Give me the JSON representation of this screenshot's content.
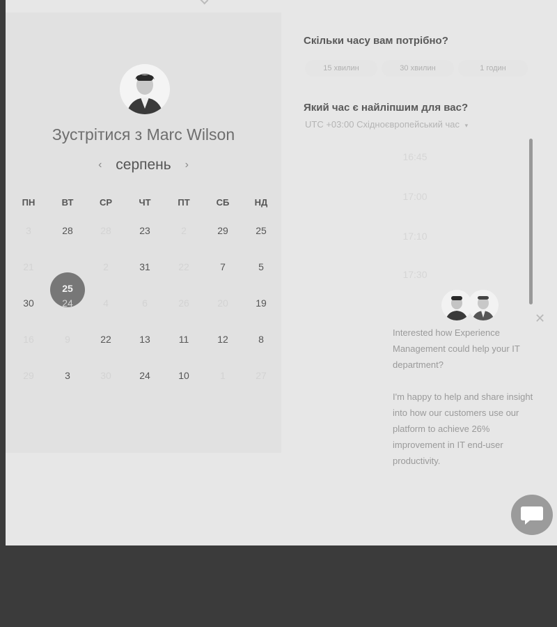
{
  "meeting": {
    "title": "Зустрітися з Marc Wilson",
    "avatar_icon": "person-photo-icon"
  },
  "calendar": {
    "month": "серпень",
    "prev_icon": "chevron-left-icon",
    "next_icon": "chevron-right-icon",
    "weekdays": [
      "ПН",
      "ВТ",
      "СР",
      "ЧТ",
      "ПТ",
      "СБ",
      "НД"
    ],
    "rows": [
      [
        {
          "t": "3",
          "dim": true
        },
        {
          "t": "28"
        },
        {
          "t": "28",
          "dim": true
        },
        {
          "t": "23"
        },
        {
          "t": "2",
          "dim": true
        },
        {
          "t": "29"
        },
        {
          "t": "25"
        }
      ],
      [
        {
          "t": "21",
          "dim": true
        },
        {
          "t": "25",
          "selected": true
        },
        {
          "t": "2",
          "dim": true
        },
        {
          "t": "31"
        },
        {
          "t": "22",
          "dim": true
        },
        {
          "t": "7"
        },
        {
          "t": "5"
        }
      ],
      [
        {
          "t": "30"
        },
        {
          "t": "24",
          "dim": true
        },
        {
          "t": "4",
          "dim": true
        },
        {
          "t": "6",
          "dim": true
        },
        {
          "t": "26",
          "dim": true
        },
        {
          "t": "20",
          "dim": true
        },
        {
          "t": "19"
        }
      ],
      [
        {
          "t": "16",
          "dim": true
        },
        {
          "t": "9",
          "dim": true
        },
        {
          "t": "22"
        },
        {
          "t": "13"
        },
        {
          "t": "11"
        },
        {
          "t": "12"
        },
        {
          "t": "8"
        }
      ],
      [
        {
          "t": "29",
          "dim": true
        },
        {
          "t": "3"
        },
        {
          "t": "30",
          "dim": true
        },
        {
          "t": "24"
        },
        {
          "t": "10"
        },
        {
          "t": "1",
          "dim": true
        },
        {
          "t": "27",
          "dim": true
        }
      ]
    ]
  },
  "scheduler": {
    "duration_question": "Скільки часу вам потрібно?",
    "durations": [
      "15 хвилин",
      "30 хвилин",
      "1 годин"
    ],
    "time_question": "Який час є найліпшим для вас?",
    "timezone": "UTC +03:00 Східноєвропейський час",
    "timezone_icon": "caret-down-icon",
    "slots": [
      "16:45",
      "17:00",
      "17:10",
      "17:30"
    ]
  },
  "chat": {
    "messages": [
      "Interested how Experience Management could help your IT department?",
      "I'm happy to help and share insight into how our customers use our platform to achieve 26% improvement in IT end-user productivity."
    ],
    "close_icon": "close-icon",
    "launcher_icon": "chat-bubble-icon"
  }
}
